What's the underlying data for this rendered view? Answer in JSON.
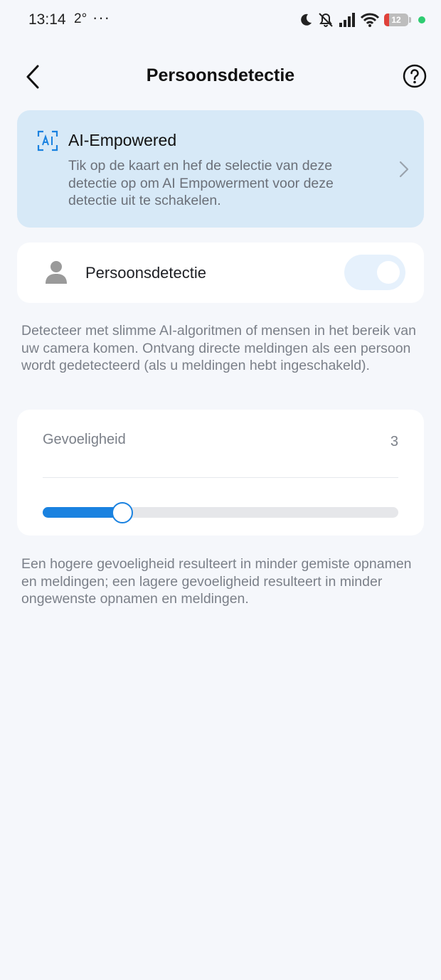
{
  "status_bar": {
    "time": "13:14",
    "temperature": "2°",
    "more": "···",
    "battery": "12",
    "icons": [
      "moon-icon",
      "bell-off-icon",
      "signal-icon",
      "wifi-icon",
      "battery-icon",
      "green-dot"
    ]
  },
  "header": {
    "title": "Persoonsdetectie",
    "back_icon": "chevron-left-icon",
    "help_icon": "help-circle-icon"
  },
  "ai_card": {
    "icon": "ai-icon",
    "title": "AI-Empowered",
    "description": "Tik op de kaart en hef de selectie van deze detectie op om AI Empowerment voor deze detectie uit te schakelen.",
    "chevron_icon": "chevron-right-icon"
  },
  "person_detection": {
    "icon": "person-icon",
    "label": "Persoonsdetectie",
    "enabled": true
  },
  "detection_description": "Detecteer met slimme AI-algoritmen of mensen in het bereik van uw camera komen. Ontvang directe meldingen als een persoon wordt gedetecteerd (als u meldingen hebt ingeschakeld).",
  "sensitivity": {
    "label": "Gevoeligheid",
    "value": "3",
    "slider_fraction": 0.22
  },
  "sensitivity_description": "Een hogere gevoeligheid resulteert in minder gemiste opnamen en meldingen; een lagere gevoeligheid resulteert in minder ongewenste opnamen en meldingen.",
  "colors": {
    "accent": "#1a82e0",
    "card_ai_bg": "#d7e9f7",
    "page_bg": "#f5f7fb",
    "toggle_bg": "#e6f1fc"
  }
}
